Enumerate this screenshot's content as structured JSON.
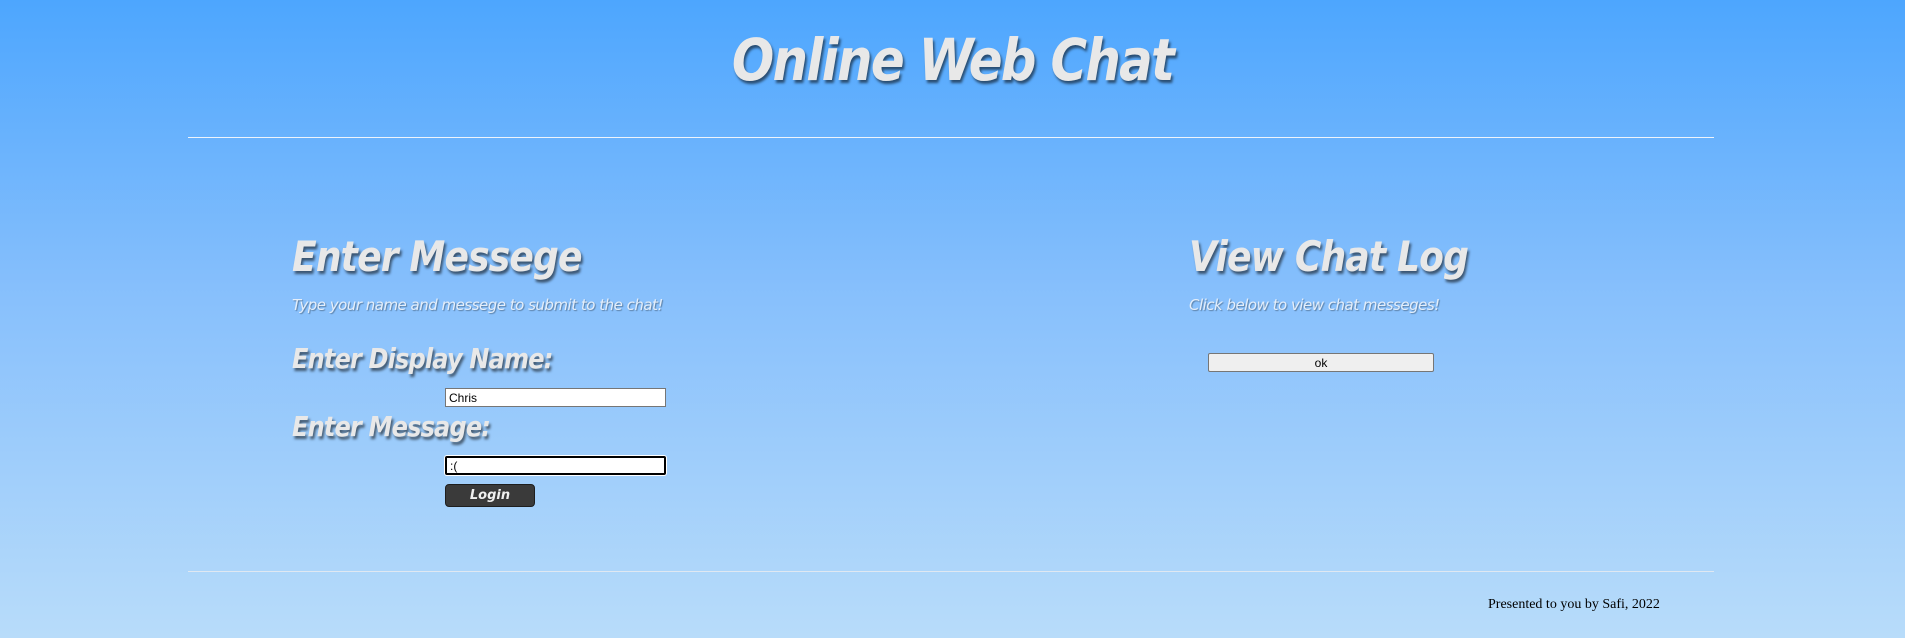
{
  "header": {
    "title": "Online Web Chat"
  },
  "message_section": {
    "heading": "Enter Messege",
    "subtitle": "Type your name and messege to submit to the chat!",
    "display_name_label": "Enter Display Name:",
    "display_name_value": "Chris",
    "message_label": "Enter Message:",
    "message_value": ":(",
    "submit_label": "Login"
  },
  "log_section": {
    "heading": "View Chat Log",
    "subtitle": "Click below to view chat messeges!",
    "button_label": "ok"
  },
  "footer": {
    "credit": "Presented to you by Safi, 2022"
  },
  "colors": {
    "background_top": "#4da6fe",
    "background_bottom": "#b8dcfa",
    "heading_text": "#e8e8e8",
    "login_button": "#3a3a3a"
  }
}
